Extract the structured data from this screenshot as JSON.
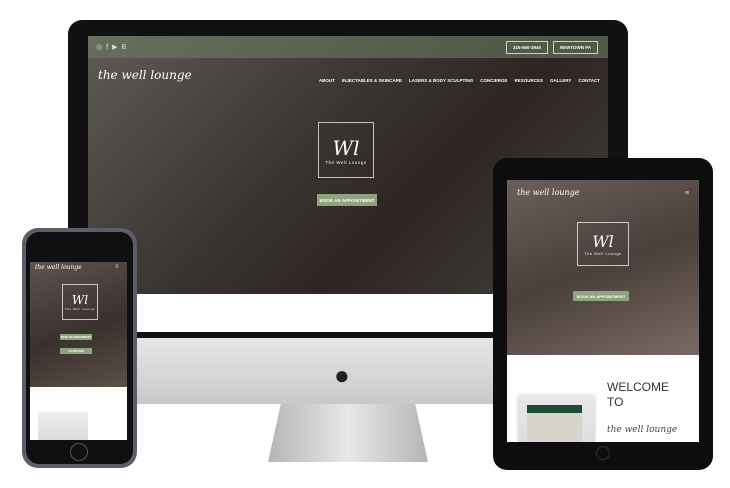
{
  "site": {
    "logo_text": "the well lounge",
    "monogram": "Wl",
    "monogram_sub": "The Well Lounge",
    "social_icons": [
      "instagram-icon",
      "facebook-icon",
      "youtube-icon",
      "blog-icon"
    ],
    "phone": "215-560-3940",
    "location": "NEWTOWN PA",
    "nav": [
      "ABOUT",
      "INJECTABLES & SKINCARE",
      "LASERS & BODY SCULPTING",
      "CONCIERGE",
      "RESOURCES",
      "GALLERY",
      "CONTACT"
    ],
    "book_label": "BOOK AN APPOINTMENT",
    "welcome": "WELCOME TO",
    "welcome_script": "the well lounge"
  },
  "colors": {
    "accent": "#8fa37c",
    "bezel": "#111111"
  }
}
